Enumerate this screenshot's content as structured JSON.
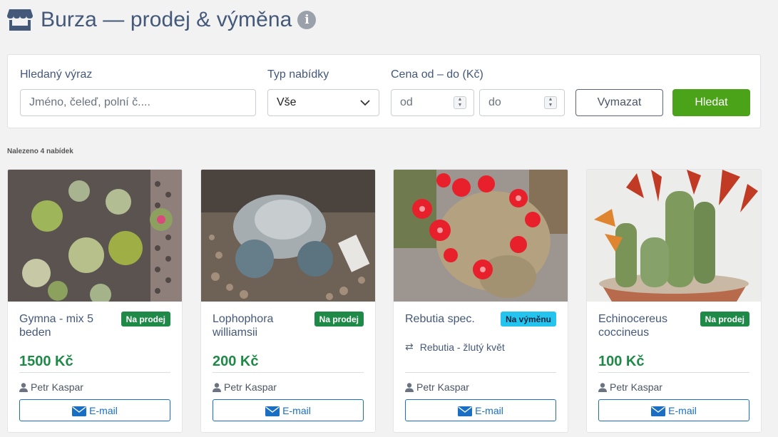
{
  "header": {
    "title": "Burza — prodej & výměna",
    "store_icon": "store-icon",
    "info_icon": "info-icon"
  },
  "filter": {
    "query_label": "Hledaný výraz",
    "query_placeholder": "Jméno, čeleď, polní č....",
    "type_label": "Typ nabídky",
    "type_value": "Vše",
    "price_label": "Cena od – do (Kč)",
    "price_from_placeholder": "od",
    "price_to_placeholder": "do",
    "clear_label": "Vymazat",
    "search_label": "Hledat"
  },
  "results": {
    "count_text": "Nalezeno 4 nabídek"
  },
  "listings": [
    {
      "name": "Gymna - mix 5 beden",
      "badge": "Na prodej",
      "price": "1500 Kč",
      "seller": "Petr Kaspar",
      "email_label": "E-mail"
    },
    {
      "name": "Lophophora williamsii",
      "badge": "Na prodej",
      "price": "200 Kč",
      "seller": "Petr Kaspar",
      "email_label": "E-mail"
    },
    {
      "name": "Rebutia spec.",
      "badge": "Na výměnu",
      "swap_for": "Rebutia - žlutý květ",
      "seller": "Petr Kaspar",
      "email_label": "E-mail"
    },
    {
      "name": "Echinocereus coccineus",
      "badge": "Na prodej",
      "price": "100 Kč",
      "seller": "Petr Kaspar",
      "email_label": "E-mail"
    }
  ],
  "colors": {
    "accent_green": "#4ba31a",
    "price_green": "#1f8a48",
    "swap_badge": "#25c4ef",
    "link_blue": "#1a6fc4",
    "title": "#44587a"
  }
}
